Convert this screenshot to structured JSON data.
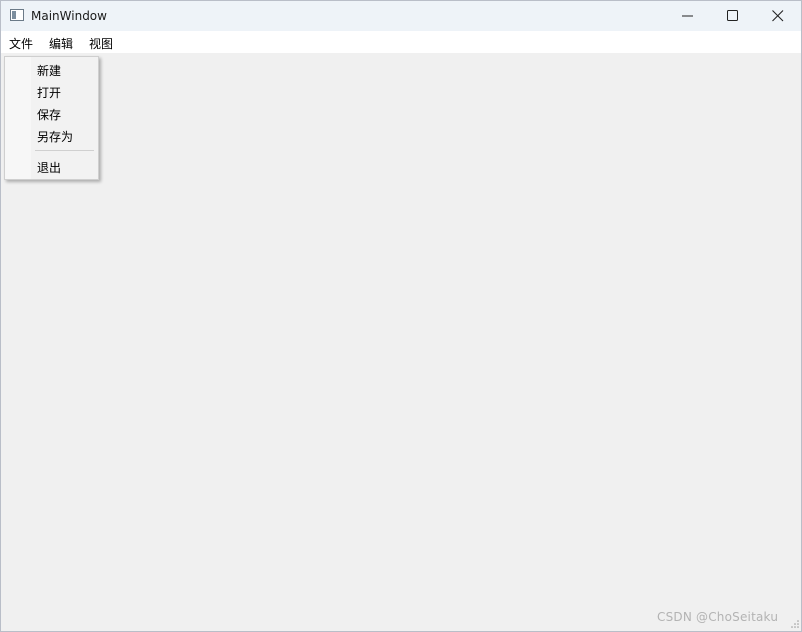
{
  "window": {
    "title": "MainWindow",
    "min_icon": "minimize-icon",
    "max_icon": "maximize-icon",
    "close_icon": "close-icon"
  },
  "menubar": {
    "items": [
      {
        "label": "文件"
      },
      {
        "label": "编辑"
      },
      {
        "label": "视图"
      }
    ]
  },
  "file_menu": {
    "items": [
      {
        "label": "新建"
      },
      {
        "label": "打开"
      },
      {
        "label": "保存"
      },
      {
        "label": "另存为"
      },
      {
        "label": "退出"
      }
    ]
  },
  "watermark": "CSDN @ChoSeitaku",
  "colors": {
    "titlebar": "#eef3f8",
    "menubar": "#ffffff",
    "client": "#f0f0f0",
    "menu_bg": "#f2f2f2"
  }
}
